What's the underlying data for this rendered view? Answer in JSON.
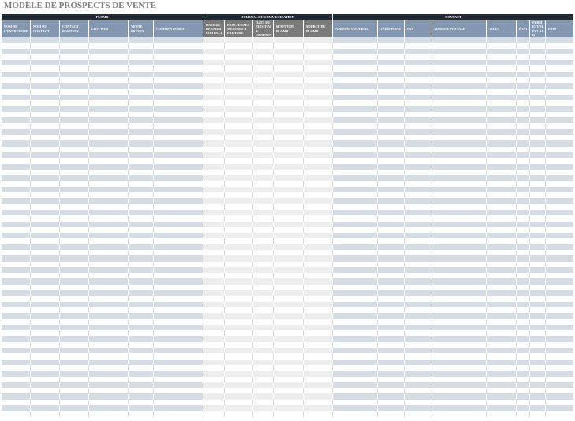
{
  "title": "MODÈLE DE PROSPECTS DE VENTE",
  "colors": {
    "title": "#7f7f7f",
    "group_header": "#222a35",
    "row_white": "#ffffff",
    "gridline": "#d9d9d9",
    "band_divider": "#ffffff"
  },
  "table": {
    "groups": [
      {
        "label": "PLOMB",
        "header_color": "#8497b0",
        "band_color": "#d6dce4",
        "columns": [
          "NOM DE L'ENTREPRISE",
          "NOM DU CONTACT",
          "CONTACT POSITION",
          "LIEN WEB",
          "VENTE PRÉVUE",
          "COMMENTAIRES"
        ]
      },
      {
        "label": "JOURNAL DE COMMUNICATION",
        "header_color": "#7a7a7a",
        "band_color": "#ededed",
        "columns": [
          "DATE DU DERNIER CONTACT",
          "PROCHAINES MESURES À PRENDRE",
          "DATE DU PROCHAIN CONTACT",
          "STATUT DU PLOMB",
          "SOURCE DU PLOMB"
        ]
      },
      {
        "label": "CONTACT",
        "header_color": "#8497b0",
        "band_color": "#d6dce4",
        "columns": [
          "ADRESSE COURRIEL",
          "TÉLÉPHONE",
          "FAX",
          "ADRESSE POSTALE",
          "VILLE",
          "ÉTAT",
          "FERMETURE ÉCLAIR",
          "PAYS"
        ]
      }
    ]
  }
}
